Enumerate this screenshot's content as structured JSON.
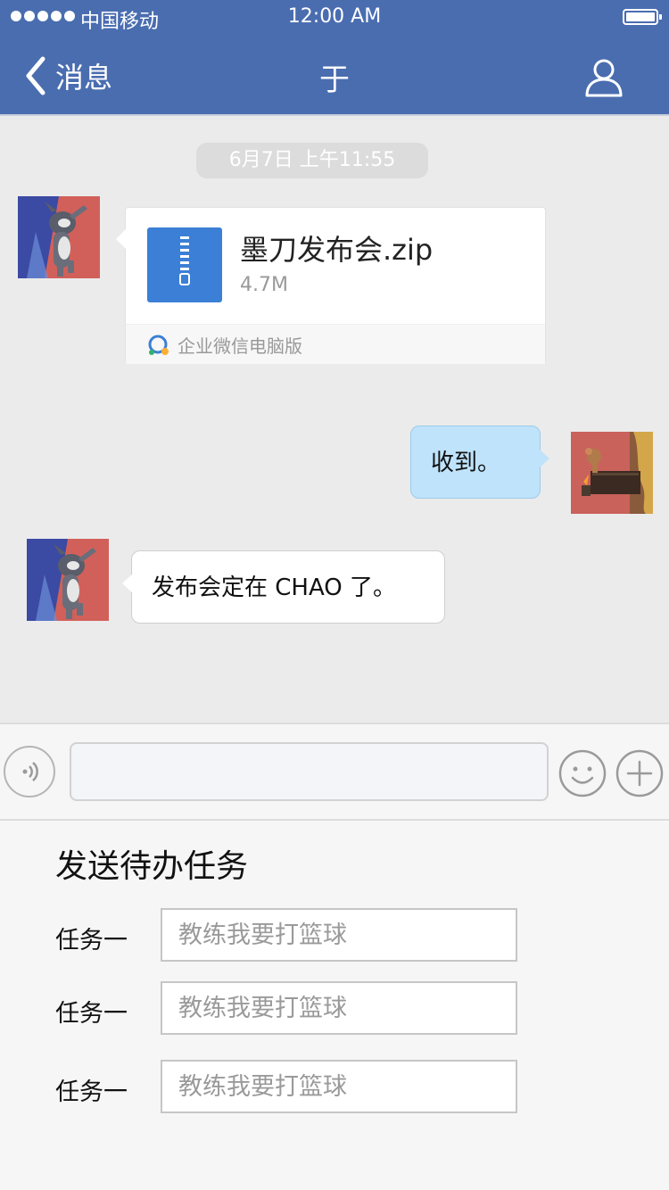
{
  "status_bar": {
    "carrier": "中国移动",
    "time": "12:00 AM"
  },
  "nav": {
    "back_label": "消息",
    "title": "于"
  },
  "chat": {
    "timestamp": "6月7日 上午11:55",
    "file_message": {
      "file_name": "墨刀发布会.zip",
      "file_size": "4.7M",
      "source": "企业微信电脑版"
    },
    "my_message": "收到。",
    "their_message": "发布会定在 CHAO 了。"
  },
  "input_bar": {
    "value": ""
  },
  "task_panel": {
    "title": "发送待办任务",
    "tasks": [
      {
        "label": "任务一",
        "placeholder": "教练我要打篮球"
      },
      {
        "label": "任务一",
        "placeholder": "教练我要打篮球"
      },
      {
        "label": "任务一",
        "placeholder": "教练我要打篮球"
      }
    ]
  },
  "colors": {
    "nav_bg": "#4a6db0",
    "chat_bg": "#ebebeb",
    "my_bubble": "#bfe3fb",
    "zip_icon": "#3b7fd6"
  },
  "icons": [
    "back-chevron-icon",
    "profile-icon",
    "zip-file-icon",
    "wecom-logo-icon",
    "voice-icon",
    "emoji-icon",
    "plus-icon"
  ]
}
